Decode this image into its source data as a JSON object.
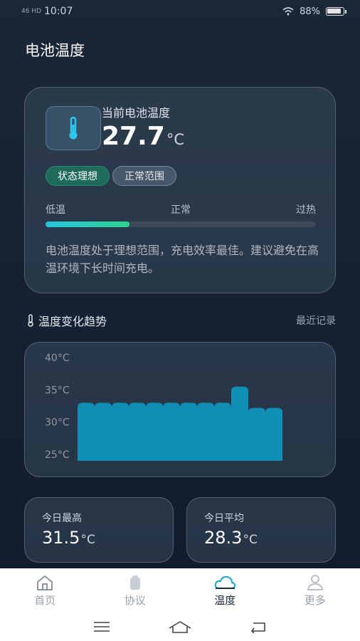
{
  "status_bar": {
    "signal_text": "46 HD",
    "time": "10:07",
    "battery": "88%"
  },
  "header": {
    "title": "电池温度"
  },
  "current": {
    "label": "当前电池温度",
    "value": "27.7",
    "unit": "°C",
    "badges": [
      "状态理想",
      "正常范围"
    ],
    "scale": [
      "低温",
      "正常",
      "过热"
    ],
    "level_fraction": 0.31,
    "description": "电池温度处于理想范围，充电效率最佳。建议避免在高温环境下长时间充电。"
  },
  "trend": {
    "title": "温度变化趋势",
    "link": "最近记录"
  },
  "chart_data": {
    "type": "bar",
    "title": "",
    "xlabel": "",
    "ylabel": "",
    "ylim": [
      24.0,
      41.0
    ],
    "y_ticks": [
      "40°C",
      "35°C",
      "30°C",
      "25°C"
    ],
    "y_tick_values": [
      40,
      35,
      30,
      25
    ],
    "categories": [
      "",
      "",
      "",
      "",
      "",
      "",
      "",
      "",
      "",
      "",
      "",
      ""
    ],
    "values": [
      33.0,
      33.0,
      33.0,
      33.0,
      33.0,
      33.0,
      33.0,
      33.0,
      33.0,
      35.5,
      32.2,
      32.2
    ],
    "bar_color": "#0f8fb5",
    "grid": false
  },
  "stats": [
    {
      "label": "今日最高",
      "value": "31.5",
      "unit": "°C"
    },
    {
      "label": "今日平均",
      "value": "28.3",
      "unit": "°C"
    }
  ],
  "tabs": [
    {
      "label": "首页",
      "icon": "home-icon",
      "active": false
    },
    {
      "label": "协议",
      "icon": "document-icon",
      "active": false
    },
    {
      "label": "温度",
      "icon": "cloud-icon",
      "active": true
    },
    {
      "label": "更多",
      "icon": "person-icon",
      "active": false
    }
  ],
  "colors": {
    "accent": "#24c6e0",
    "good": "#1e6b5c"
  }
}
